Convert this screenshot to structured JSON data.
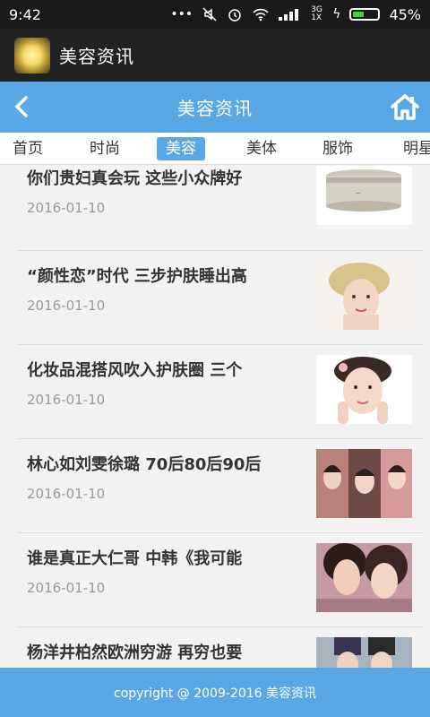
{
  "status_bar": {
    "time": "9:42",
    "network_label": "3G 1X",
    "battery_percent": "45%",
    "battery_level": 0.45,
    "icons": [
      "more-dots-icon",
      "mute-icon",
      "alarm-icon",
      "wifi-icon",
      "signal-icon",
      "charging-icon",
      "battery-icon"
    ]
  },
  "app_bar": {
    "title": "美容资讯"
  },
  "nav_bar": {
    "title": "美容资讯",
    "back_icon": "chevron-left-icon",
    "home_icon": "home-icon"
  },
  "tabs": [
    {
      "label": "首页"
    },
    {
      "label": "时尚"
    },
    {
      "label": "美容",
      "active": true
    },
    {
      "label": "美体"
    },
    {
      "label": "服饰"
    },
    {
      "label": "明星"
    }
  ],
  "articles": [
    {
      "title": "你们贵妇真会玩 这些小众牌好",
      "date": "2016-01-10",
      "thumb": "cream-jar-image"
    },
    {
      "title": "“颜性恋”时代 三步护肤睡出高",
      "date": "2016-01-10",
      "thumb": "woman-curly-hair-image"
    },
    {
      "title": "化妆品混搭风吹入护肤圈 三个",
      "date": "2016-01-10",
      "thumb": "woman-hands-face-image"
    },
    {
      "title": "林心如刘雯徐璐 70后80后90后",
      "date": "2016-01-10",
      "thumb": "three-women-image"
    },
    {
      "title": "谁是真正大仁哥 中韩《我可能",
      "date": "2016-01-10",
      "thumb": "two-women-selfie-image"
    },
    {
      "title": "杨洋井柏然欧洲穷游 再穷也要",
      "date": "",
      "thumb": "two-men-image"
    }
  ],
  "footer": {
    "text": "copyright @ 2009-2016 美容资讯"
  },
  "colors": {
    "accent": "#5aa7e6",
    "app_bar": "#222222",
    "status_bar": "#1a1a1a",
    "battery_fill": "#3fd23f"
  }
}
